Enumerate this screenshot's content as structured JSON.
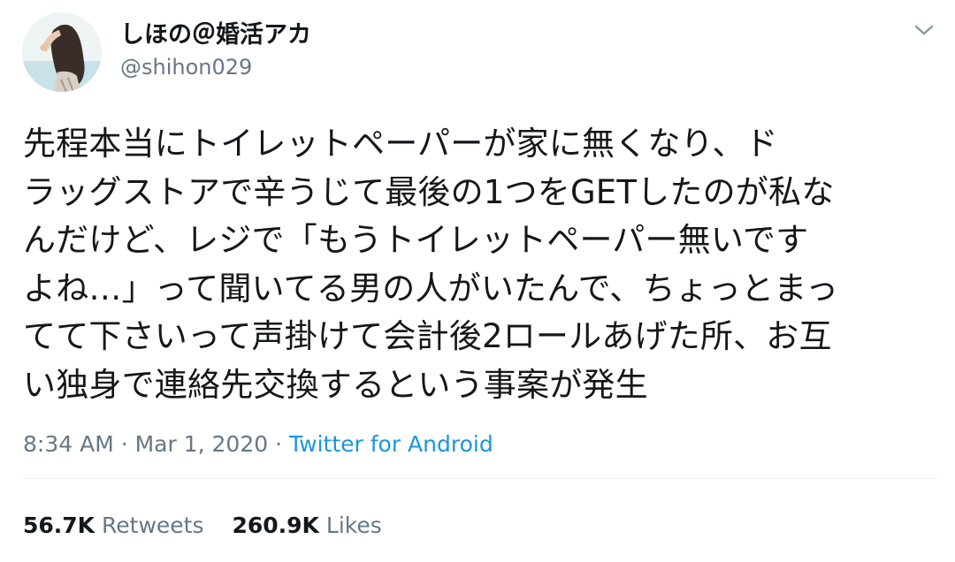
{
  "tweet": {
    "display_name": "しほの＠婚活アカ",
    "handle": "@shihon029",
    "text": "先程本当にトイレットペーパーが家に無くなり、ド\nラッグストアで辛うじて最後の1つをGETしたのが私な\nんだけど、レジで「もうトイレットペーパー無いです\nよね…」って聞いてる男の人がいたんで、ちょっとまっ\nてて下さいって声掛けて会計後2ロールあげた所、お互\nい独身で連絡先交換するという事案が発生",
    "time": "8:34 AM",
    "separator": " · ",
    "date": "Mar 1, 2020",
    "source": "Twitter for Android",
    "retweets_count": "56.7K",
    "retweets_label": "Retweets",
    "likes_count": "260.9K",
    "likes_label": "Likes"
  },
  "icons": {
    "menu": "chevron-down-icon",
    "avatar": "profile-avatar"
  },
  "colors": {
    "primary_text": "#14171a",
    "secondary_text": "#657786",
    "link": "#1b95e0",
    "divider": "#e6ecf0"
  }
}
